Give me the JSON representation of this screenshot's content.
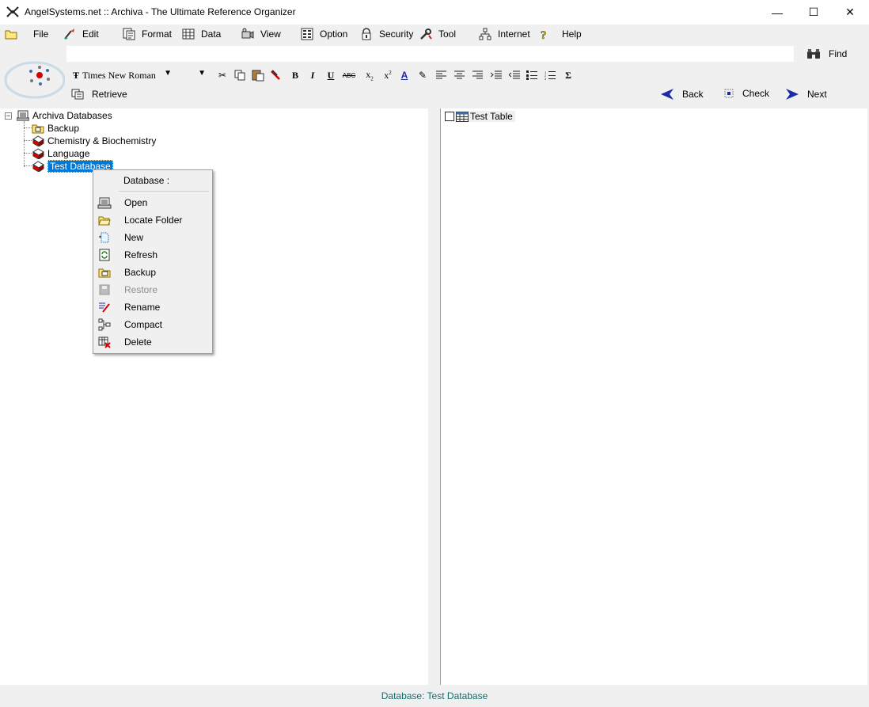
{
  "window": {
    "title": "AngelSystems.net :: Archiva - The Ultimate Reference Organizer",
    "minimize": "—",
    "maximize": "☐",
    "close": "✕"
  },
  "menubar": {
    "items": [
      {
        "label": "File",
        "icon": "folder-icon"
      },
      {
        "label": "Edit",
        "icon": "brush-icon"
      },
      {
        "label": "Format",
        "icon": "format-icon"
      },
      {
        "label": "Data",
        "icon": "grid-icon"
      },
      {
        "label": "View",
        "icon": "camera-icon"
      },
      {
        "label": "Option",
        "icon": "option-icon"
      },
      {
        "label": "Security",
        "icon": "lock-icon"
      },
      {
        "label": "Tool",
        "icon": "tool-icon"
      },
      {
        "label": "Internet",
        "icon": "network-icon"
      },
      {
        "label": "Help",
        "icon": "help-icon"
      }
    ]
  },
  "toolbar": {
    "address_value": "",
    "find_label": "Find",
    "font_name": "Times New Roman",
    "font_size": "",
    "retrieve_label": "Retrieve",
    "back_label": "Back",
    "check_label": "Check",
    "next_label": "Next"
  },
  "tree": {
    "root": "Archiva Databases",
    "items": [
      {
        "label": "Backup"
      },
      {
        "label": "Chemistry & Biochemistry"
      },
      {
        "label": "Language"
      },
      {
        "label": "Test Database",
        "selected": true
      }
    ]
  },
  "right_panel": {
    "items": [
      {
        "label": "Test Table"
      }
    ]
  },
  "context_menu": {
    "header": "Database :",
    "items": [
      {
        "label": "Open",
        "icon": "database-open-icon",
        "enabled": true
      },
      {
        "label": "Locate Folder",
        "icon": "folder-open-icon",
        "enabled": true
      },
      {
        "label": "New",
        "icon": "new-icon",
        "enabled": true
      },
      {
        "label": "Refresh",
        "icon": "refresh-icon",
        "enabled": true
      },
      {
        "label": "Backup",
        "icon": "backup-icon",
        "enabled": true
      },
      {
        "label": "Restore",
        "icon": "restore-icon",
        "enabled": false
      },
      {
        "label": "Rename",
        "icon": "rename-icon",
        "enabled": true
      },
      {
        "label": "Compact",
        "icon": "compact-icon",
        "enabled": true
      },
      {
        "label": "Delete",
        "icon": "delete-icon",
        "enabled": true
      }
    ]
  },
  "statusbar": {
    "text": "Database: Test Database"
  },
  "colors": {
    "selection": "#0078d7",
    "status_text": "#0c6f6f",
    "nav_arrow": "#1a2aa8"
  }
}
